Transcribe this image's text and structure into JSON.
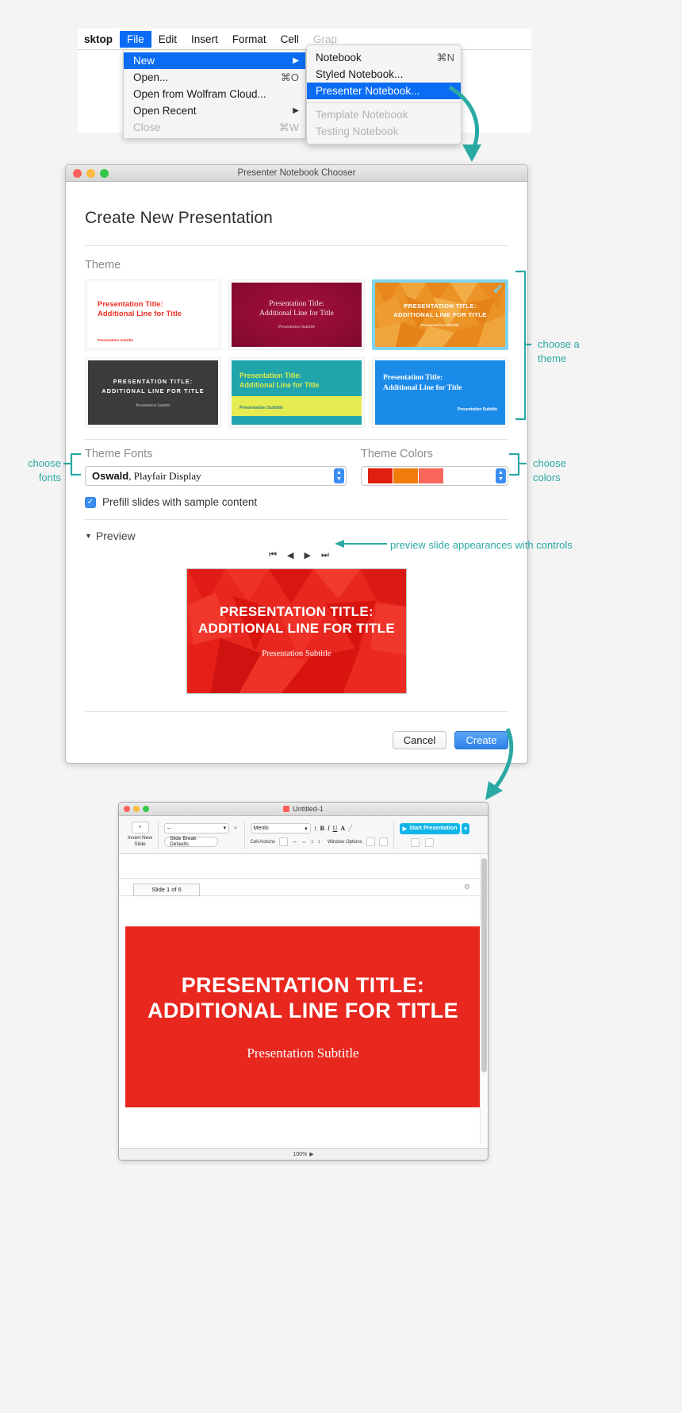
{
  "menu": {
    "menubar": [
      {
        "label": "sktop",
        "state": "app"
      },
      {
        "label": "File",
        "state": "selected"
      },
      {
        "label": "Edit",
        "state": "normal"
      },
      {
        "label": "Insert",
        "state": "normal"
      },
      {
        "label": "Format",
        "state": "normal"
      },
      {
        "label": "Cell",
        "state": "normal"
      },
      {
        "label": "Grap",
        "state": "dim"
      }
    ],
    "file_menu": [
      {
        "label": "New",
        "shortcut": "",
        "submenu": true,
        "state": "selected"
      },
      {
        "label": "Open...",
        "shortcut": "⌘O",
        "submenu": false,
        "state": "normal"
      },
      {
        "label": "Open from Wolfram Cloud...",
        "shortcut": "",
        "submenu": false,
        "state": "normal"
      },
      {
        "label": "Open Recent",
        "shortcut": "",
        "submenu": true,
        "state": "normal"
      },
      {
        "label": "Close",
        "shortcut": "⌘W",
        "submenu": false,
        "state": "dim"
      }
    ],
    "new_submenu": [
      {
        "label": "Notebook",
        "shortcut": "⌘N",
        "state": "normal"
      },
      {
        "label": "Styled Notebook...",
        "shortcut": "",
        "state": "normal"
      },
      {
        "label": "Presenter Notebook...",
        "shortcut": "",
        "state": "selected"
      },
      {
        "label": "Template Notebook",
        "shortcut": "",
        "state": "dim"
      },
      {
        "label": "Testing Notebook",
        "shortcut": "",
        "state": "dim"
      }
    ]
  },
  "dialog": {
    "window_title": "Presenter Notebook Chooser",
    "heading": "Create New Presentation",
    "theme_label": "Theme",
    "themes": [
      {
        "id": "theme-light-red",
        "title": "Presentation Title:\nAdditional Line for Title",
        "subtitle": "Presentation Subtitle",
        "selected": false
      },
      {
        "id": "theme-maroon",
        "title": "Presentation Title:\nAdditional Line for Title",
        "subtitle": "Presentation Subtitle",
        "selected": false
      },
      {
        "id": "theme-orange-polygon",
        "title": "PRESENTATION TITLE:\nADDITIONAL LINE FOR TITLE",
        "subtitle": "Presentation Subtitle",
        "selected": true
      },
      {
        "id": "theme-dark",
        "title": "PRESENTATION TITLE:\nADDITIONAL LINE FOR TITLE",
        "subtitle": "Presentation Subtitle",
        "selected": false
      },
      {
        "id": "theme-teal-yellow",
        "title": "Presentation Title:\nAdditional Line for Title",
        "subtitle": "Presentation Subtitle",
        "selected": false
      },
      {
        "id": "theme-blue",
        "title": "Presentation Title:\nAdditional Line for Title",
        "subtitle": "Presentation Subtitle",
        "selected": false
      }
    ],
    "theme_fonts_label": "Theme Fonts",
    "theme_fonts_value_head": "Oswald",
    "theme_fonts_value_tail": ", Playfair Display",
    "theme_colors_label": "Theme Colors",
    "theme_colors_swatches": [
      "#e01f10",
      "#f07c0c",
      "#f8665a"
    ],
    "prefill_label": "Prefill slides with sample content",
    "prefill_checked": true,
    "check_glyph": "✓",
    "preview_label": "Preview",
    "preview_triangle": "▼",
    "nav_first": "⏮",
    "nav_prev": "◀",
    "nav_next": "▶",
    "nav_last": "⏭",
    "preview_slide": {
      "title_line1": "PRESENTATION TITLE:",
      "title_line2": "ADDITIONAL LINE FOR TITLE",
      "subtitle": "Presentation Subtitle"
    },
    "cancel_label": "Cancel",
    "create_label": "Create"
  },
  "annotations": {
    "choose_a_theme_line1": "choose a",
    "choose_a_theme_line2": "theme",
    "choose_fonts_line1": "choose",
    "choose_fonts_line2": "fonts",
    "choose_colors_line1": "choose",
    "choose_colors_line2": "colors",
    "preview_controls": "preview slide appearances with controls"
  },
  "notebook": {
    "window_title": "Untitled-1",
    "insert_new_slide_label": "Insert New\nSlide",
    "insert_new_slide_icon": "+",
    "style_combo_value": "–",
    "slide_break_defaults": "Slide Break Defaults",
    "font_combo_value": "Menlo",
    "format_icons": [
      "B",
      "I",
      "U",
      "A"
    ],
    "cell_actions_label": "Cell Actions",
    "window_options_label": "Window Options",
    "start_presentation_label": "Start Presentation",
    "slide_tab_label": "Slide 1 of 6",
    "gear_icon": "⚙",
    "slide": {
      "title_line1": "PRESENTATION TITLE:",
      "title_line2": "ADDITIONAL LINE FOR TITLE",
      "subtitle": "Presentation Subtitle"
    },
    "zoom_level": "100%",
    "zoom_arrow": "▶"
  },
  "colors": {
    "teal_annotation": "#2aa9a3",
    "selection_blue": "#0a6cf5",
    "accent_blue": "#3b8ef3",
    "selected_theme_border": "#7fd4ef",
    "slide_red": "#e8271f",
    "start_presentation_cyan": "#12b5e8"
  }
}
